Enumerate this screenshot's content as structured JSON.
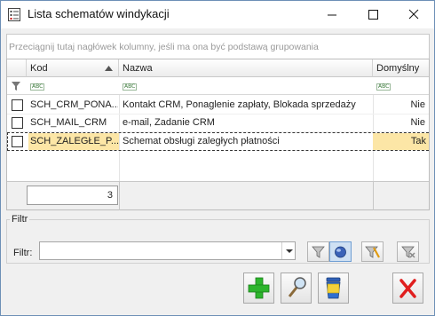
{
  "window": {
    "title": "Lista schematów windykacji"
  },
  "grid": {
    "group_hint": "Przeciągnij tutaj nagłówek kolumny, jeśli ma ona być podstawą grupowania",
    "columns": [
      {
        "label": "Kod",
        "sort": "ascending"
      },
      {
        "label": "Nazwa"
      },
      {
        "label": "Domyślny"
      }
    ],
    "filter_row_icon": "funnel-icon",
    "filter_mode_label": "ABC",
    "rows": [
      {
        "kod": "SCH_CRM_PONA...",
        "nazwa": "Kontakt CRM, Ponaglenie zapłaty, Blokada sprzedaży",
        "domyslny": "Nie",
        "selected": false
      },
      {
        "kod": "SCH_MAIL_CRM",
        "nazwa": "e-mail, Zadanie CRM",
        "domyslny": "Nie",
        "selected": false
      },
      {
        "kod": "SCH_ZALEGŁE_P...",
        "nazwa": "Schemat obsługi zaległych płatności",
        "domyslny": "Tak",
        "selected": true
      }
    ],
    "row_count": "3"
  },
  "filter": {
    "group_label": "Filtr",
    "field_label": "Filtr:",
    "value": "",
    "buttons": [
      "filter-icon",
      "filter-active-icon",
      "filter-builder-icon",
      "filter-clear-icon"
    ]
  },
  "actions": {
    "buttons": [
      "add-icon",
      "edit-icon",
      "delete-icon",
      "close-icon"
    ]
  },
  "colors": {
    "selection": "#fce6a6",
    "add": "#2db52d",
    "close": "#e01f1f"
  }
}
